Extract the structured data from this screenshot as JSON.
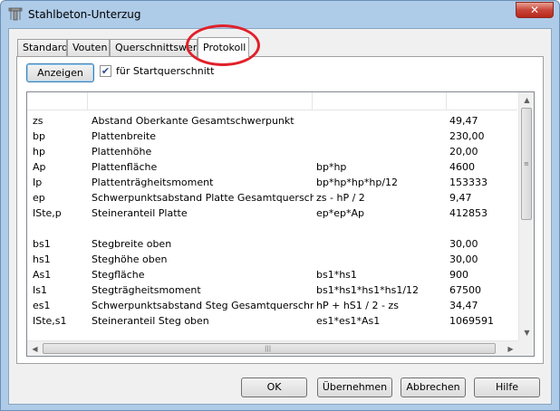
{
  "window": {
    "title": "Stahlbeton-Unterzug",
    "close_label": "✕"
  },
  "tabs": [
    {
      "label": "Standard"
    },
    {
      "label": "Vouten"
    },
    {
      "label": "Querschnittswerte"
    },
    {
      "label": "Protokoll"
    }
  ],
  "toolbar": {
    "show_label": "Anzeigen",
    "checkbox_label": "für Startquerschnitt",
    "checkbox_checked": true
  },
  "table": {
    "rows": [
      [
        "zs",
        "Abstand Oberkante Gesamtschwerpunkt",
        "",
        "49,47"
      ],
      [
        "bp",
        "Plattenbreite",
        "",
        "230,00"
      ],
      [
        "hp",
        "Plattenhöhe",
        "",
        "20,00"
      ],
      [
        "Ap",
        "Plattenfläche",
        "bp*hp",
        "4600"
      ],
      [
        "Ip",
        "Plattenträgheitsmoment",
        "bp*hp*hp*hp/12",
        "153333"
      ],
      [
        "ep",
        "Schwerpunktsabstand Platte Gesamtquerschnitt",
        "zs - hP / 2",
        "9,47"
      ],
      [
        "ISte,p",
        "Steineranteil Platte",
        "ep*ep*Ap",
        "412853"
      ],
      [
        "",
        "",
        "",
        ""
      ],
      [
        "bs1",
        "Stegbreite oben",
        "",
        "30,00"
      ],
      [
        "hs1",
        "Steghöhe oben",
        "",
        "30,00"
      ],
      [
        "As1",
        "Stegfläche",
        "bs1*hs1",
        "900"
      ],
      [
        "Is1",
        "Stegträgheitsmoment",
        "bs1*hs1*hs1*hs1/12",
        "67500"
      ],
      [
        "es1",
        "Schwerpunktsabstand Steg Gesamtquerschnitt",
        "hP + hS1 / 2 - zs",
        "34,47"
      ],
      [
        "ISte,s1",
        "Steineranteil Steg oben",
        "es1*es1*As1",
        "1069591"
      ]
    ]
  },
  "buttons": {
    "ok": "OK",
    "apply": "Übernehmen",
    "cancel": "Abbrechen",
    "help": "Hilfe"
  },
  "colors": {
    "window_frame": "#aecbe8",
    "highlight_oval": "#e0212a"
  },
  "icons": {
    "app": "column-icon",
    "scroll_up": "▲",
    "scroll_down": "▼",
    "scroll_left": "◀",
    "scroll_right": "▶"
  }
}
